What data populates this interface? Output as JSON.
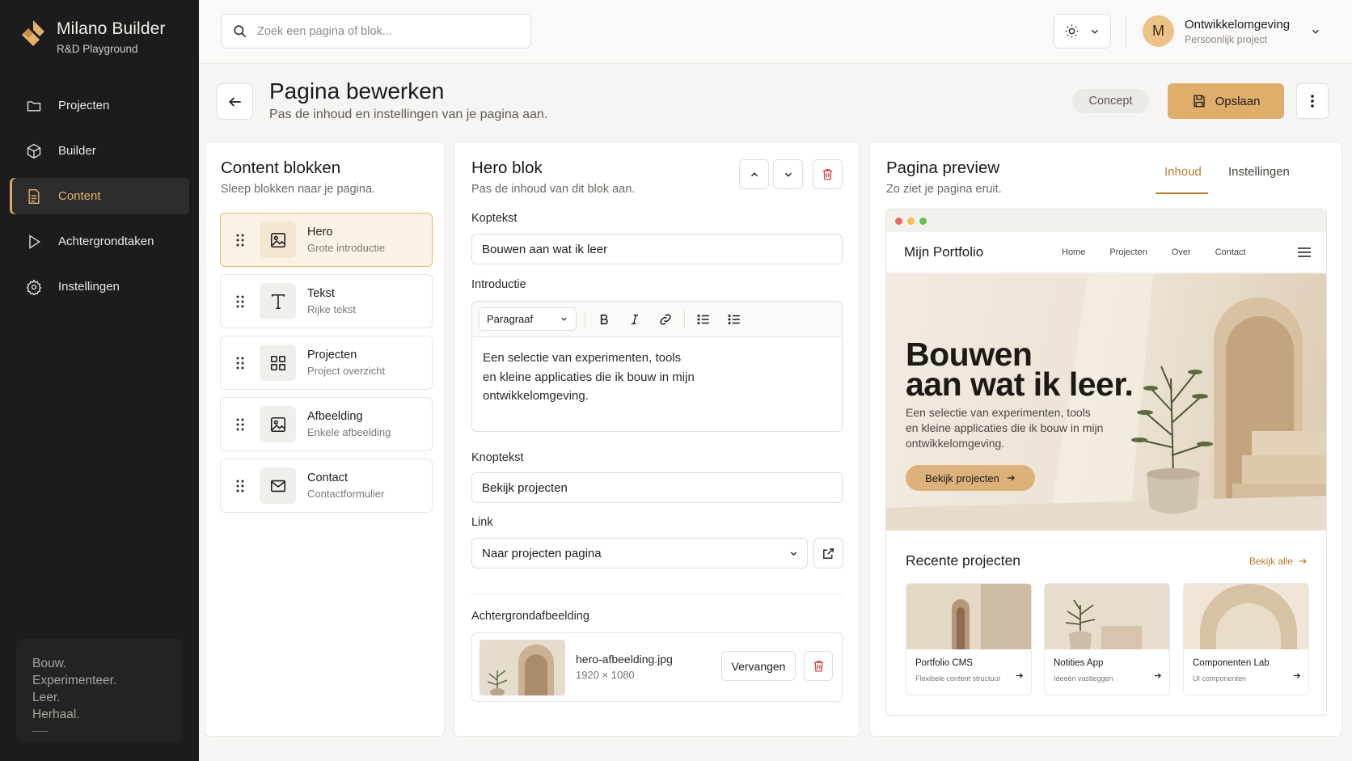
{
  "app": {
    "title": "Milano Builder",
    "subtitle": "R&D Playground"
  },
  "sidebar": {
    "items": [
      {
        "label": "Projecten",
        "icon": "folder-icon",
        "active": false
      },
      {
        "label": "Builder",
        "icon": "cube-icon",
        "active": false
      },
      {
        "label": "Content",
        "icon": "document-icon",
        "active": true
      },
      {
        "label": "Achtergrondtaken",
        "icon": "play-icon",
        "active": false
      },
      {
        "label": "Instellingen",
        "icon": "gear-icon",
        "active": false
      }
    ],
    "quote": [
      "Bouw.",
      "Experimenteer.",
      "Leer.",
      "Herhaal."
    ]
  },
  "topbar": {
    "search_placeholder": "Zoek een pagina of blok...",
    "user": {
      "initial": "M",
      "name": "Ontwikkelomgeving",
      "sub": "Persoonlijk project"
    }
  },
  "header": {
    "title": "Pagina bewerken",
    "subtitle": "Pas de inhoud en instellingen van je pagina aan.",
    "status": "Concept",
    "save_label": "Opslaan"
  },
  "blocks_panel": {
    "title": "Content blokken",
    "subtitle": "Sleep blokken naar je pagina.",
    "items": [
      {
        "name": "Hero",
        "desc": "Grote introductie",
        "icon": "image-icon",
        "selected": true
      },
      {
        "name": "Tekst",
        "desc": "Rijke tekst",
        "icon": "text-icon",
        "selected": false
      },
      {
        "name": "Projecten",
        "desc": "Project overzicht",
        "icon": "grid-icon",
        "selected": false
      },
      {
        "name": "Afbeelding",
        "desc": "Enkele afbeelding",
        "icon": "image-icon",
        "selected": false
      },
      {
        "name": "Contact",
        "desc": "Contactformulier",
        "icon": "mail-icon",
        "selected": false
      }
    ]
  },
  "editor_panel": {
    "title": "Hero blok",
    "subtitle": "Pas de inhoud van dit blok aan.",
    "heading_label": "Koptekst",
    "heading_value": "Bouwen aan wat ik leer",
    "intro_label": "Introductie",
    "format_value": "Paragraaf",
    "intro_lines": [
      "Een selectie van experimenten, tools",
      "en kleine applicaties die ik bouw in mijn",
      "ontwikkelomgeving."
    ],
    "button_label": "Knoptekst",
    "button_value": "Bekijk projecten",
    "link_label": "Link",
    "link_value": "Naar projecten pagina",
    "bg_label": "Achtergrondafbeelding",
    "file_name": "hero-afbeelding.jpg",
    "file_size": "1920 × 1080",
    "replace_label": "Vervangen"
  },
  "preview_panel": {
    "title": "Pagina preview",
    "subtitle": "Zo ziet je pagina eruit.",
    "tabs": [
      {
        "label": "Inhoud",
        "active": true
      },
      {
        "label": "Instellingen",
        "active": false
      }
    ],
    "site": {
      "logo": "Mijn Portfolio",
      "nav": [
        "Home",
        "Projecten",
        "Over",
        "Contact"
      ],
      "hero_lines": [
        "Bouwen",
        "aan wat ik leer."
      ],
      "hero_text_lines": [
        "Een selectie van experimenten, tools",
        "en kleine applicaties die ik bouw in mijn",
        "ontwikkelomgeving."
      ],
      "hero_button": "Bekijk projecten",
      "recent_title": "Recente projecten",
      "see_all": "Bekijk alle",
      "cards": [
        {
          "title": "Portfolio CMS",
          "desc": "Flexibele content structuur"
        },
        {
          "title": "Notities App",
          "desc": "Ideeën vastleggen"
        },
        {
          "title": "Componenten Lab",
          "desc": "UI componenten"
        }
      ]
    }
  },
  "colors": {
    "accent": "#e0ae6b",
    "sidebar_bg": "#1c1c1c",
    "danger": "#d2463c",
    "active_tab": "#b97a30"
  }
}
